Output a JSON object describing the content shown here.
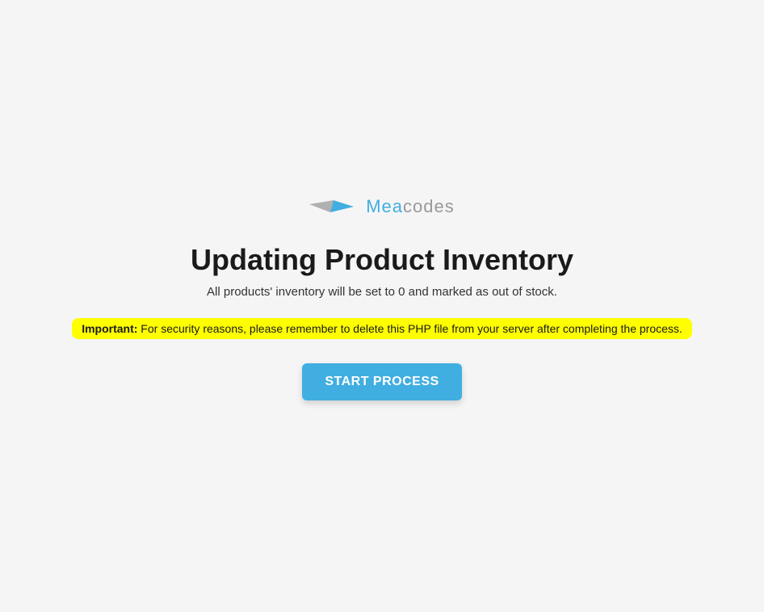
{
  "logo": {
    "brand_first": "Mea",
    "brand_second": "codes"
  },
  "heading": {
    "title": "Updating Product Inventory",
    "subtitle": "All products' inventory will be set to 0 and marked as out of stock."
  },
  "warning": {
    "label": "Important:",
    "message": " For security reasons, please remember to delete this PHP file from your server after completing the process."
  },
  "actions": {
    "start_button_label": "START PROCESS"
  }
}
